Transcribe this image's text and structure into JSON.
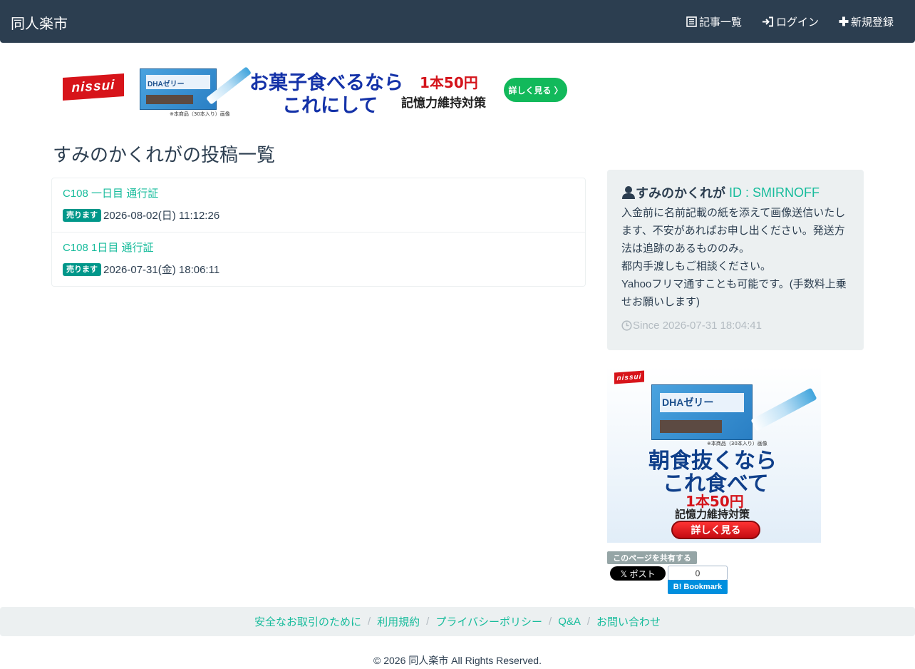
{
  "navbar": {
    "brand": "同人楽市",
    "links": [
      {
        "icon": "list-icon",
        "label": "記事一覧"
      },
      {
        "icon": "login-icon",
        "label": "ログイン"
      },
      {
        "icon": "plus-icon",
        "label": "新規登録"
      }
    ]
  },
  "banner_top": {
    "logo": "nissui",
    "headline_1": "お菓子食べるなら",
    "headline_2": "これにして",
    "price": "1本50円",
    "tagline": "記憶力維持対策",
    "button": "詳しく見る 〉",
    "product_name": "DHAゼリー",
    "caption": "※本商品（30本入り）画像"
  },
  "page_title": "すみのかくれがの投稿一覧",
  "posts": [
    {
      "title": "C108 一日目 通行証",
      "badge": "売ります",
      "date": "2026-08-02(日) 11:12:26"
    },
    {
      "title": "C108 1日目 通行証",
      "badge": "売ります",
      "date": "2026-07-31(金) 18:06:11"
    }
  ],
  "profile": {
    "icon": "user-icon",
    "name": "すみのかくれが",
    "id_label": "ID : SMIRNOFF",
    "bio": "入金前に名前記載の紙を添えて画像送信いたします、不安があればお申し出ください。発送方法は追跡のあるもののみ。\n都内手渡しもご相談ください。\nYahooフリマ通すことも可能です。(手数料上乗せお願いします)",
    "since": "Since 2026-07-31 18:04:41"
  },
  "side_ad": {
    "logo": "nissui",
    "product_name": "DHAゼリー",
    "caption": "※本商品（30本入り）画像",
    "headline_1": "朝食抜くなら",
    "headline_2": "これ食べて",
    "price": "1本50円",
    "tagline": "記憶力維持対策",
    "button": "詳しく見る"
  },
  "share": {
    "label": "このページを共有する",
    "x_post": "𝕏 ポスト",
    "hatena_count": "0",
    "hatena_label": "B! Bookmark"
  },
  "footer": {
    "links": [
      "安全なお取引のために",
      "利用規約",
      "プライバシーポリシー",
      "Q&A",
      "お問い合わせ"
    ],
    "copyright": "© 2026 同人楽市 All Rights Reserved."
  },
  "colors": {
    "navbar": "#2c3e50",
    "accent": "#18bc9c",
    "badge": "#00978a",
    "panel": "#ecf0f1"
  }
}
